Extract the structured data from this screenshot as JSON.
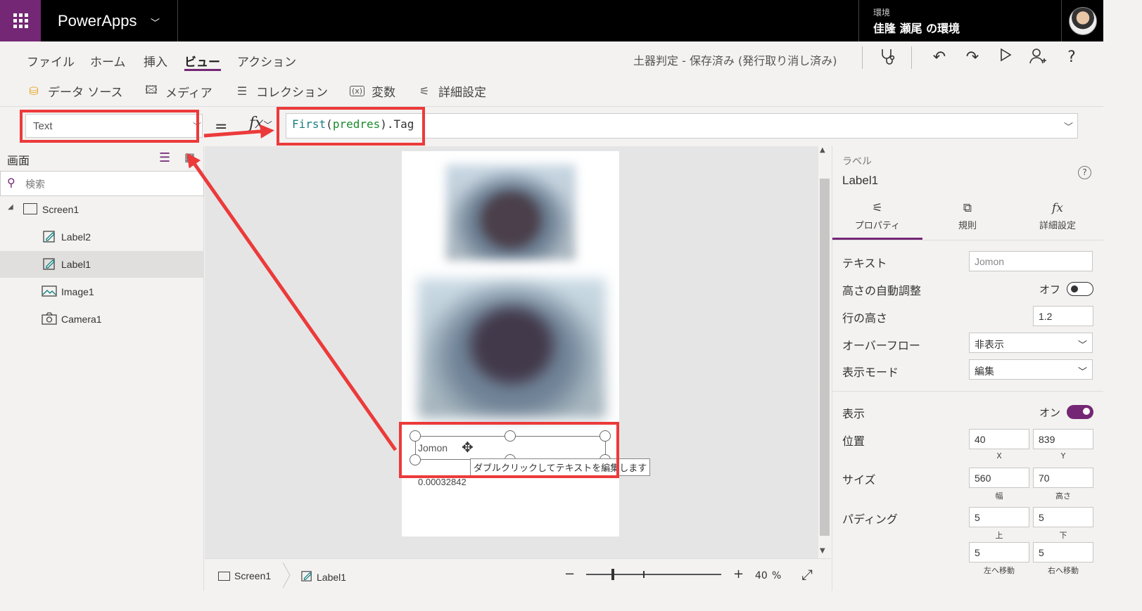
{
  "app": {
    "title": "PowerApps"
  },
  "environment": {
    "label": "環境",
    "name": "佳隆 瀬尾 の環境"
  },
  "menu": {
    "items": [
      "ファイル",
      "ホーム",
      "挿入",
      "ビュー",
      "アクション"
    ],
    "active": "ビュー",
    "status": "土器判定 - 保存済み (発行取り消し済み)"
  },
  "toolbar_icons": [
    "stethoscope-icon",
    "undo-icon",
    "redo-icon",
    "play-icon",
    "share-user-icon",
    "help-icon"
  ],
  "subtoolbar": {
    "items": [
      {
        "label": "データ ソース",
        "icon": "database-icon"
      },
      {
        "label": "メディア",
        "icon": "media-icon"
      },
      {
        "label": "コレクション",
        "icon": "list-icon"
      },
      {
        "label": "変数",
        "icon": "variable-icon"
      },
      {
        "label": "詳細設定",
        "icon": "sliders-icon"
      }
    ]
  },
  "formula_bar": {
    "property": "Text",
    "equals": "=",
    "fx": "fx",
    "formula": {
      "fn": "First",
      "open": "(",
      "arg": "predres",
      "close": ")",
      "tail": ".Tag"
    }
  },
  "tree": {
    "title": "画面",
    "search_placeholder": "検索",
    "items": [
      {
        "label": "Screen1",
        "icon": "screen-icon",
        "level": 0
      },
      {
        "label": "Label2",
        "icon": "label-edit-icon",
        "level": 1
      },
      {
        "label": "Label1",
        "icon": "label-edit-icon",
        "level": 1,
        "selected": true
      },
      {
        "label": "Image1",
        "icon": "image-icon",
        "level": 1
      },
      {
        "label": "Camera1",
        "icon": "camera-icon",
        "level": 1
      }
    ]
  },
  "canvas": {
    "label1_text": "Jomon",
    "tooltip": "ダブルクリックしてテキストを編集します",
    "label2_text": "0.00032842"
  },
  "status_bar": {
    "crumbs": [
      "Screen1",
      "Label1"
    ],
    "zoom_value": "40",
    "zoom_unit": "%"
  },
  "properties": {
    "type": "ラベル",
    "name": "Label1",
    "tabs": [
      "プロパティ",
      "規則",
      "詳細設定"
    ],
    "active_tab": "プロパティ",
    "text_label": "テキスト",
    "text_value": "Jomon",
    "autoheight_label": "高さの自動調整",
    "autoheight_state": "オフ",
    "lineheight_label": "行の高さ",
    "lineheight_value": "1.2",
    "overflow_label": "オーバーフロー",
    "overflow_value": "非表示",
    "displaymode_label": "表示モード",
    "displaymode_value": "編集",
    "visible_label": "表示",
    "visible_state": "オン",
    "position_label": "位置",
    "position_x": "40",
    "position_y": "839",
    "x_caption": "X",
    "y_caption": "Y",
    "size_label": "サイズ",
    "size_w": "560",
    "size_h": "70",
    "w_caption": "幅",
    "h_caption": "高さ",
    "padding_label": "パディング",
    "pad_top": "5",
    "pad_bottom": "5",
    "pad_left": "5",
    "pad_right": "5",
    "top_caption": "上",
    "bottom_caption": "下",
    "left_caption": "左へ移動",
    "right_caption": "右へ移動"
  },
  "colors": {
    "accent": "#742774",
    "annotation": "#ec3a3a",
    "formula_fn": "#1f7d7d",
    "formula_id": "#1a8a2a"
  }
}
